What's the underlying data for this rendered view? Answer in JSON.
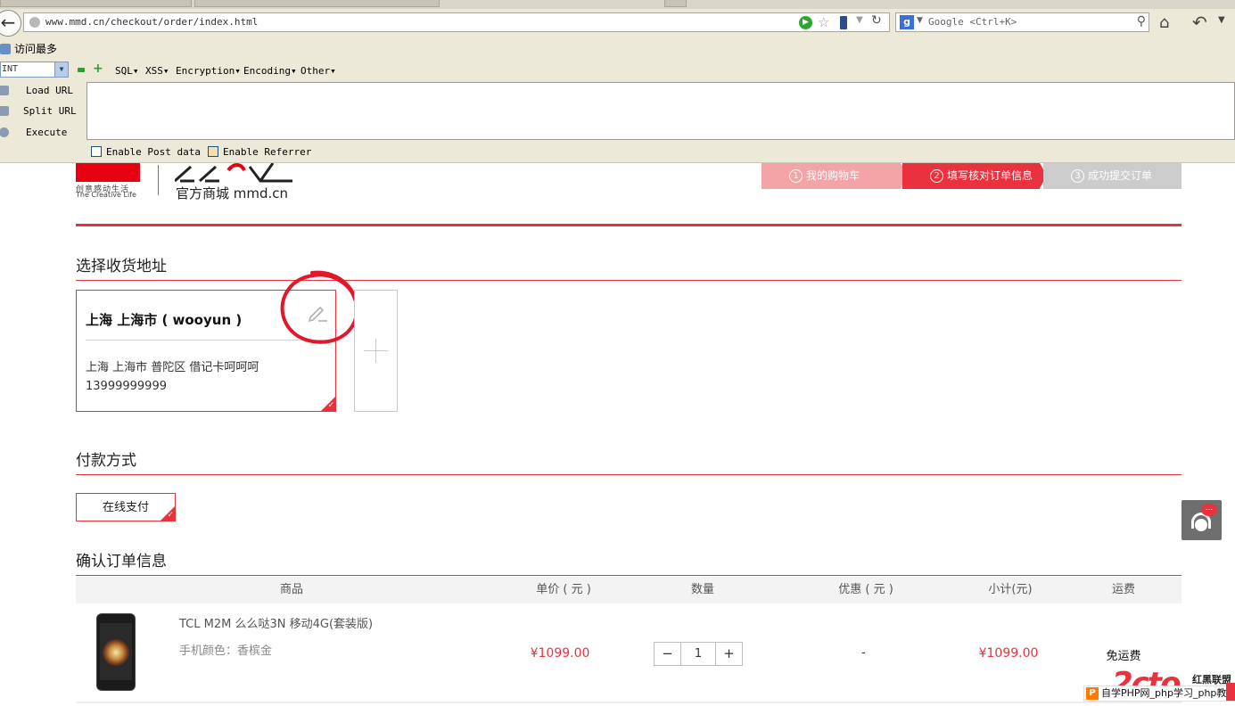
{
  "browser": {
    "url": "www.mmd.cn/checkout/order/index.html",
    "search_placeholder": "Google <Ctrl+K>",
    "search_engine_letter": "g",
    "bookmark": "访问最多"
  },
  "hackbar": {
    "type_select": "INT",
    "menus": [
      "SQL▾",
      "XSS▾",
      "Encryption▾",
      "Encoding▾",
      "Other▾"
    ],
    "actions": [
      "Load URL",
      "Split URL",
      "Execute"
    ],
    "enable_post": "Enable Post data",
    "enable_referrer": "Enable Referrer"
  },
  "header": {
    "logo_sub_cn": "创意感动生活",
    "logo_sub_en": "The Creative Life",
    "brand_text": "官方商城 mmd.cn",
    "steps": [
      {
        "num": "1",
        "label": "我的购物车"
      },
      {
        "num": "2",
        "label": "填写核对订单信息"
      },
      {
        "num": "3",
        "label": "成功提交订单"
      }
    ]
  },
  "address_section": {
    "title": "选择收货地址",
    "card": {
      "name": "上海 上海市 ( wooyun )",
      "address": "上海 上海市 普陀区 借记卡呵呵呵",
      "phone": "13999999999"
    }
  },
  "payment_section": {
    "title": "付款方式",
    "method": "在线支付"
  },
  "order_section": {
    "title": "确认订单信息",
    "columns": [
      "商品",
      "单价 ( 元 )",
      "数量",
      "优惠 ( 元 )",
      "小计(元)",
      "运费"
    ],
    "item": {
      "name": "TCL M2M 么么哒3N 移动4G(套装版)",
      "attr": "手机颜色：香槟金",
      "unit_price": "¥1099.00",
      "quantity": "1",
      "discount": "-",
      "subtotal": "¥1099.00",
      "shipping": "免运费"
    }
  },
  "watermark": {
    "brand": "红黑联盟",
    "bar_text": "自学PHP网_php学习_php教",
    "bar_icon": "P"
  },
  "colors": {
    "accent": "#e9323d",
    "step_done": "#f4a3a6",
    "step_pending": "#cccccc"
  }
}
